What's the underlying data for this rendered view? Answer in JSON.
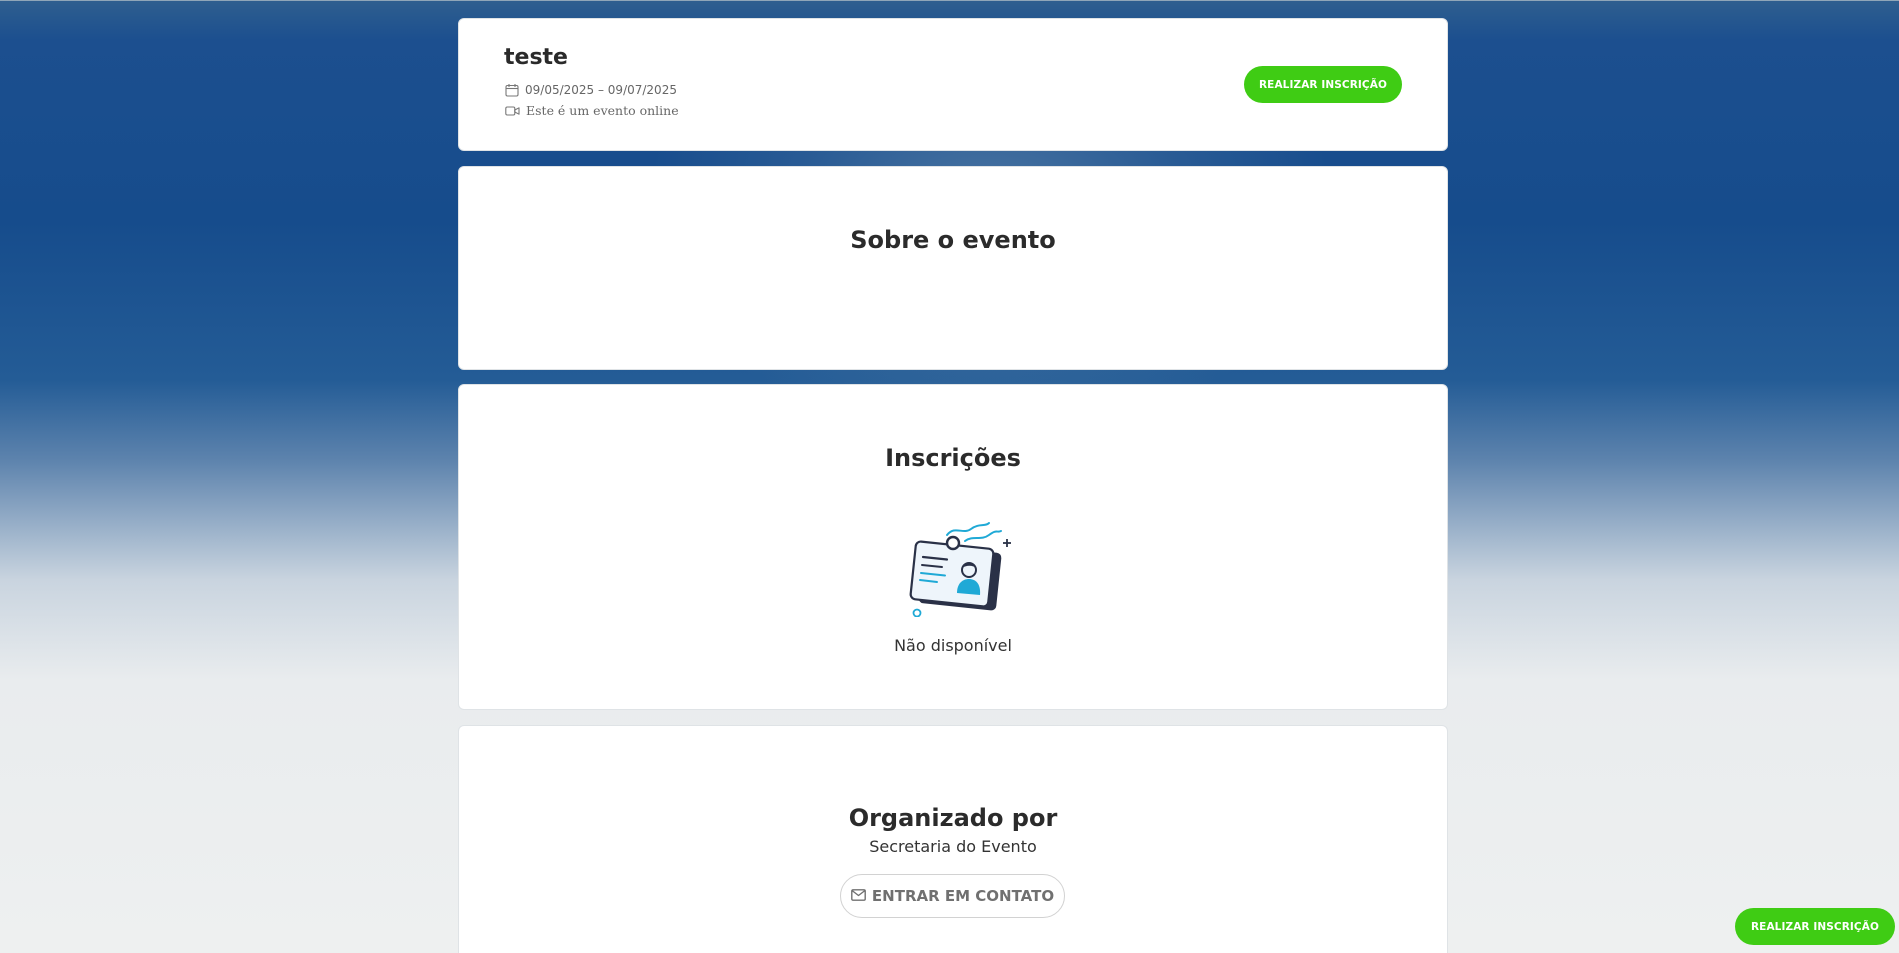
{
  "event": {
    "title": "teste",
    "dates": "09/05/2025 – 09/07/2025",
    "online_note": "Este é um evento online",
    "register_label": "REALIZAR INSCRIÇÃO"
  },
  "about": {
    "title": "Sobre o evento"
  },
  "registrations": {
    "title": "Inscrições",
    "status": "Não disponível",
    "illustration_icon": "id-badge-illustration"
  },
  "organizer": {
    "title": "Organizado por",
    "name": "Secretaria do Evento",
    "contact_label": "ENTRAR EM CONTATO"
  },
  "floating": {
    "register_label": "REALIZAR INSCRIÇÃO"
  },
  "colors": {
    "accent_green": "#3fcc14",
    "header_blue": "#164c8c",
    "badge_cyan": "#1fa9d6",
    "badge_dark": "#2a3147"
  }
}
